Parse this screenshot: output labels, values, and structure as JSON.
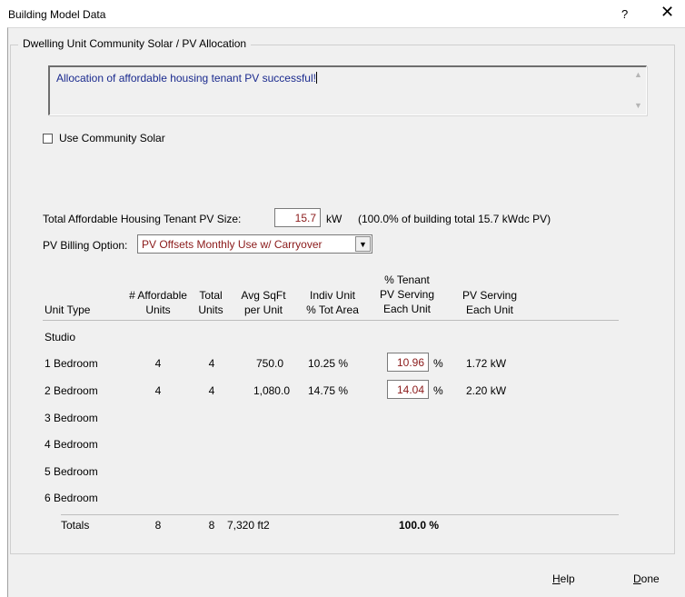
{
  "window": {
    "title": "Building Model Data",
    "help_glyph": "?",
    "close_glyph": "✕"
  },
  "group": {
    "title": "Dwelling Unit Community Solar / PV Allocation"
  },
  "message": {
    "text": "Allocation of affordable housing tenant PV successful!"
  },
  "community_solar": {
    "label": "Use Community Solar",
    "checked": false
  },
  "pv_size": {
    "label": "Total Affordable Housing Tenant PV Size:",
    "value": "15.7",
    "unit": "kW",
    "note": "(100.0% of building total 15.7 kWdc PV)"
  },
  "billing": {
    "label": "PV Billing Option:",
    "selected": "PV Offsets Monthly Use w/ Carryover"
  },
  "table": {
    "headers": {
      "unit_type": "Unit Type",
      "affordable_1": "# Affordable",
      "affordable_2": "Units",
      "total_1": "Total",
      "total_2": "Units",
      "avg_1": "Avg SqFt",
      "avg_2": "per Unit",
      "indiv_1": "Indiv Unit",
      "indiv_2": "% Tot Area",
      "tenant_1": "% Tenant",
      "tenant_2": "PV Serving",
      "tenant_3": "Each Unit",
      "serving_1": "PV Serving",
      "serving_2": "Each Unit"
    },
    "rows": [
      {
        "type": "Studio",
        "affordable": "",
        "total": "",
        "avg": "",
        "indiv": "",
        "pct": "",
        "pct_sign": "",
        "kw": ""
      },
      {
        "type": "1 Bedroom",
        "affordable": "4",
        "total": "4",
        "avg": "750.0",
        "indiv": "10.25 %",
        "pct": "10.96",
        "pct_sign": "%",
        "kw": "1.72 kW"
      },
      {
        "type": "2 Bedroom",
        "affordable": "4",
        "total": "4",
        "avg": "1,080.0",
        "indiv": "14.75 %",
        "pct": "14.04",
        "pct_sign": "%",
        "kw": "2.20 kW"
      },
      {
        "type": "3 Bedroom",
        "affordable": "",
        "total": "",
        "avg": "",
        "indiv": "",
        "pct": "",
        "pct_sign": "",
        "kw": ""
      },
      {
        "type": "4 Bedroom",
        "affordable": "",
        "total": "",
        "avg": "",
        "indiv": "",
        "pct": "",
        "pct_sign": "",
        "kw": ""
      },
      {
        "type": "5 Bedroom",
        "affordable": "",
        "total": "",
        "avg": "",
        "indiv": "",
        "pct": "",
        "pct_sign": "",
        "kw": ""
      },
      {
        "type": "6 Bedroom",
        "affordable": "",
        "total": "",
        "avg": "",
        "indiv": "",
        "pct": "",
        "pct_sign": "",
        "kw": ""
      }
    ],
    "totals": {
      "label": "Totals",
      "affordable": "8",
      "total": "8",
      "area": "7,320 ft2",
      "pct": "100.0 %"
    }
  },
  "buttons": {
    "help_prefix": "",
    "help_key": "H",
    "help_rest": "elp",
    "done_key": "D",
    "done_rest": "one"
  }
}
